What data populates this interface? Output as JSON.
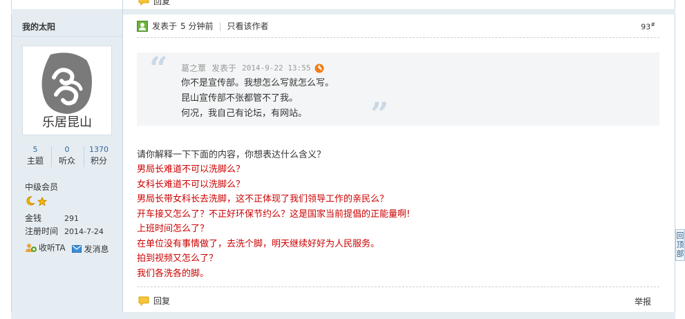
{
  "prev_post": {
    "reply_label": "回复"
  },
  "author": {
    "username": "我的太阳",
    "avatar_text": "乐居昆山",
    "stats": [
      {
        "value": "5",
        "label": "主题"
      },
      {
        "value": "0",
        "label": "听众"
      },
      {
        "value": "1370",
        "label": "积分"
      }
    ],
    "rank": "中级会员",
    "money_label": "金钱",
    "money_value": "291",
    "regtime_label": "注册时间",
    "regtime_value": "2014-7-24",
    "follow_label": "收听TA",
    "message_label": "发消息"
  },
  "post": {
    "posted_label": "发表于",
    "posted_time": "5 分钟前",
    "only_author_label": "只看该作者",
    "floor_number": "93",
    "floor_suffix": "#"
  },
  "quote": {
    "author": "葛之覃",
    "posted_label": "发表于",
    "time": "2014-9-22 13:55",
    "lines": [
      "你不是宣传部。我想怎么写就怎么写。",
      "昆山宣传部不张都管不了我。",
      "何况，我自己有论坛，有网站。"
    ]
  },
  "body": {
    "lead": "请你解释一下下面的内容，你想表达什么含义？",
    "lines": [
      "男局长难道不可以洗脚么？",
      "女科长难道不可以洗脚么？",
      "男局长带女科长去洗脚，这不正体现了我们领导工作的亲民么？",
      "开车接又怎么了？不正好环保节约么？这是国家当前提倡的正能量啊!",
      "上班时间怎么了？",
      "在单位没有事情做了，去洗个脚，明天继续好好为人民服务。",
      "拍到视频又怎么了？",
      "我们各洗各的脚。"
    ],
    "highlight_color": "#cc0000"
  },
  "footer": {
    "reply_label": "回复",
    "report_label": "举报"
  },
  "scroll_top": {
    "label": "回顶部"
  },
  "icons": {
    "reply": "speech-bubble-icon",
    "posted": "user-post-icon",
    "quote_jump": "circle-arrow-icon",
    "follow": "follow-user-icon",
    "message": "envelope-icon",
    "medal_moon": "moon-medal-icon",
    "medal_star": "star-medal-icon"
  }
}
